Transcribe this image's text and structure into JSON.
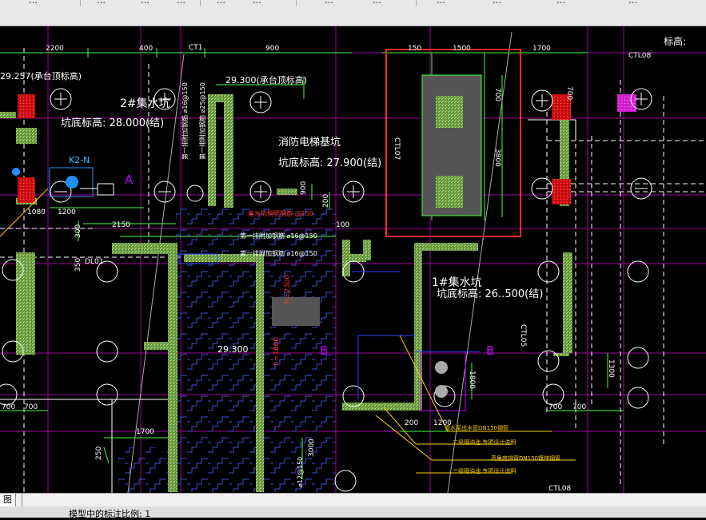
{
  "menubar": {
    "items": [
      "…",
      "…",
      "…",
      "…",
      "…",
      "…",
      "…",
      "…",
      "…",
      "…",
      "…",
      "…"
    ]
  },
  "drawing": {
    "labels": {
      "dim_2200": "2200",
      "dim_400": "400",
      "ct1": "CT1",
      "dim_900_top": "900",
      "dim_150": "150",
      "dim_1500": "1500",
      "dim_1700": "1700",
      "elev_right": "标高:",
      "ct108_top": "CTL08",
      "elev_29257": "29.257(承台顶标高)",
      "elev_29300_cap": "29.300(承台顶标高)",
      "sump2_title": "2#集水坑",
      "sump2_bottom": "坑底标高: 28.000(结)",
      "fire_pit_title": "消防电梯基坑",
      "fire_pit_bottom": "坑底标高: 27.900(结)",
      "ctl07": "CTL07",
      "dim_700_red": "700",
      "dim_3800": "3800",
      "dim_900_mid": "900",
      "dim_200": "200",
      "pump": "K2-N",
      "axis_a": "A",
      "dim_1080": "1080",
      "dim_1200": "1200",
      "dim_2150": "2150",
      "dim_300": "300",
      "dim_100": "100",
      "dl01": "DL01",
      "dim_350": "350",
      "red_note": "集水坑侧壁钢筋 @150",
      "rebar_1": "第一排附加钢筋 ⌀16@150",
      "rebar_2": "第一排附加钢筋 ⌀16@150",
      "sump1_title": "1#集水坑",
      "sump1_bottom": "坑底标高: 26..500(结)",
      "ctl05": "CTL05",
      "elev_29300": "29.300",
      "axis_b1": "B",
      "axis_b2": "B",
      "dim_1300": "1300",
      "dim_1800": "1800",
      "dim_700a": "700",
      "dim_700b": "700",
      "dim_700c": "700",
      "dim_700d": "700",
      "dim_200b": "200",
      "dim_1200b": "1200",
      "dim_1700b": "1700",
      "dim_250": "250",
      "dim_3000": "3000",
      "note_y1": "潜水泵出水管DN150钢管",
      "note_y2": "三级隔油池,专项设计说明",
      "note_y3": "高角度排管DN150镀锌钢管",
      "note_y4": "三级隔油池,专项设计说明",
      "ctl08_bottom": "CTL08",
      "v_label_1": "第一排附加钢筋 ⌀16@150",
      "v_label_2": "第一排附加钢筋 ⌀25@150",
      "v_red_1": "h=2300",
      "v_red_2": "h=1600",
      "v_small": "⌀12@150"
    }
  },
  "tabs": {
    "model": "图",
    "curve": ""
  },
  "status": {
    "text": "模型中的标注比例: 1"
  },
  "colors": {
    "highlight": "#ff2a2a",
    "green_hatch": "#7fbf5a",
    "white": "#ffffff",
    "magenta": "#c000c0"
  }
}
